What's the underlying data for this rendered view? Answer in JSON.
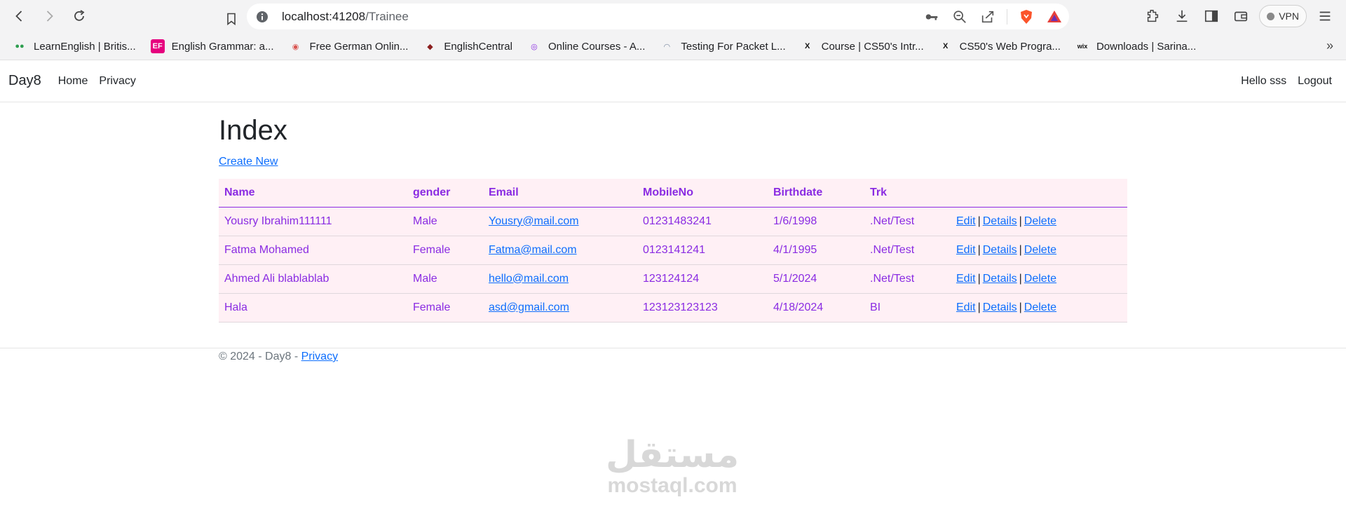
{
  "browser": {
    "url_host": "localhost:41208",
    "url_path": "/Trainee",
    "vpn_label": "VPN",
    "bookmarks": [
      {
        "label": "LearnEnglish | Britis...",
        "icon": "british-council-icon",
        "color": "#2e9e4f"
      },
      {
        "label": "English Grammar: a...",
        "icon": "ef-icon",
        "color": "#e6007e"
      },
      {
        "label": "Free German Onlin...",
        "icon": "german-flag-icon",
        "color": "#d9534f"
      },
      {
        "label": "EnglishCentral",
        "icon": "englishcentral-icon",
        "color": "#8b1e1e"
      },
      {
        "label": "Online Courses - A...",
        "icon": "udemy-icon",
        "color": "#8a2be2"
      },
      {
        "label": "Testing For Packet L...",
        "icon": "packet-icon",
        "color": "#7a8aa0"
      },
      {
        "label": "Course | CS50's Intr...",
        "icon": "edx-icon",
        "color": "#111111"
      },
      {
        "label": "CS50's Web Progra...",
        "icon": "edx-icon",
        "color": "#111111"
      },
      {
        "label": "Downloads | Sarina...",
        "icon": "wix-icon",
        "color": "#111111"
      }
    ]
  },
  "app": {
    "brand": "Day8",
    "nav": [
      "Home",
      "Privacy"
    ],
    "greeting": "Hello sss",
    "logout": "Logout"
  },
  "page": {
    "title": "Index",
    "create_link": "Create New",
    "columns": [
      "Name",
      "gender",
      "Email",
      "MobileNo",
      "Birthdate",
      "Trk"
    ],
    "rows": [
      {
        "name": "Yousry Ibrahim111111",
        "gender": "Male",
        "email": "Yousry@mail.com",
        "mobile": "01231483241",
        "birthdate": "1/6/1998",
        "trk": ".Net/Test"
      },
      {
        "name": "Fatma Mohamed",
        "gender": "Female",
        "email": "Fatma@mail.com",
        "mobile": "0123141241",
        "birthdate": "4/1/1995",
        "trk": ".Net/Test"
      },
      {
        "name": "Ahmed Ali blablablab",
        "gender": "Male",
        "email": "hello@mail.com",
        "mobile": "123124124",
        "birthdate": "5/1/2024",
        "trk": ".Net/Test"
      },
      {
        "name": "Hala",
        "gender": "Female",
        "email": "asd@gmail.com",
        "mobile": "123123123123",
        "birthdate": "4/18/2024",
        "trk": "BI"
      }
    ],
    "actions": {
      "edit": "Edit",
      "details": "Details",
      "delete": "Delete",
      "separator": "|"
    }
  },
  "footer": {
    "text": "© 2024 - Day8 - ",
    "privacy": "Privacy"
  },
  "watermark": {
    "arabic": "مستقل",
    "latin": "mostaql.com"
  },
  "colors": {
    "table_bg": "#fff0f5",
    "table_text": "#8a2be2",
    "link": "#0d6efd"
  }
}
